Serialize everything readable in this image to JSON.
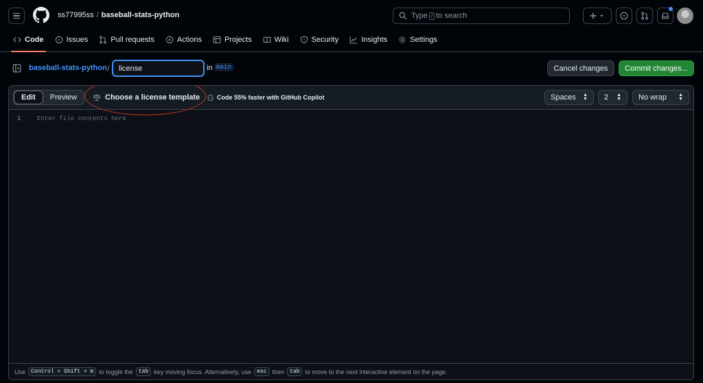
{
  "header": {
    "owner": "ss77995ss",
    "separator": "/",
    "repo": "baseball-stats-python",
    "search_text_before": "Type",
    "search_key": "/",
    "search_text_after": "to search"
  },
  "nav": {
    "tabs": [
      {
        "label": "Code",
        "icon": "code-icon",
        "active": true
      },
      {
        "label": "Issues",
        "icon": "issue-icon"
      },
      {
        "label": "Pull requests",
        "icon": "pull-request-icon"
      },
      {
        "label": "Actions",
        "icon": "play-icon"
      },
      {
        "label": "Projects",
        "icon": "table-icon"
      },
      {
        "label": "Wiki",
        "icon": "book-icon"
      },
      {
        "label": "Security",
        "icon": "shield-icon"
      },
      {
        "label": "Insights",
        "icon": "graph-icon"
      },
      {
        "label": "Settings",
        "icon": "gear-icon"
      }
    ]
  },
  "filebar": {
    "repo_link": "baseball-stats-python",
    "slash": "/",
    "filename": "license",
    "in_label": "in",
    "branch": "main",
    "cancel_label": "Cancel changes",
    "commit_label": "Commit changes..."
  },
  "editor": {
    "edit_label": "Edit",
    "preview_label": "Preview",
    "license_label": "Choose a license template",
    "copilot_label": "Code 55% faster with GitHub Copilot",
    "indent_mode": "Spaces",
    "indent_size": "2",
    "wrap_mode": "No wrap",
    "line_number": "1",
    "placeholder": "Enter file contents here"
  },
  "footer": {
    "t1": "Use",
    "k1": "Control + Shift + m",
    "t2": "to toggle the",
    "k2": "tab",
    "t3": "key moving focus. Alternatively, use",
    "k3": "esc",
    "t4": "then",
    "k4": "tab",
    "t5": "to move to the next interactive element on the page."
  },
  "colors": {
    "accent_blue": "#4493f8",
    "commit_green": "#238636",
    "active_tab_underline": "#f78166",
    "annotation_red": "#d23a22"
  }
}
